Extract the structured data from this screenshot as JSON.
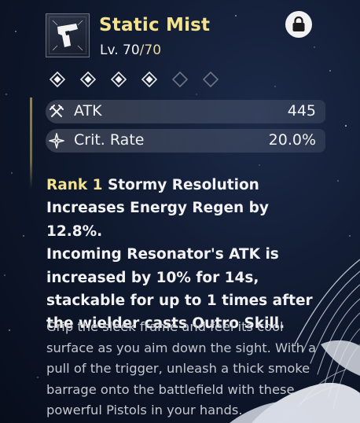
{
  "weapon": {
    "name": "Static Mist",
    "level_prefix": "Lv. ",
    "level_current": "70",
    "level_max": "/70",
    "icon": "pistol-icon",
    "locked": true
  },
  "rank_diamonds": [
    {
      "filled": true
    },
    {
      "filled": true
    },
    {
      "filled": true
    },
    {
      "filled": true
    },
    {
      "filled": false
    },
    {
      "filled": false
    }
  ],
  "stats": [
    {
      "icon": "atk-crossed-swords-icon",
      "label": "ATK",
      "value": "445"
    },
    {
      "icon": "crit-rate-sparkle-icon",
      "label": "Crit. Rate",
      "value": "20.0%"
    }
  ],
  "passive": {
    "rank": "Rank 1",
    "name": "Stormy Resolution",
    "line1": "Increases Energy Regen by 12.8%.",
    "line2": "Incoming Resonator's ATK is increased by 10% for 14s, stackable for up to 1 times after the wielder casts Outro Skill."
  },
  "lore": "Grip the sleek frame and feel its cool surface as you aim down the sight. With a pull of the trigger, unleash a thick smoke barrage onto the battlefield with these powerful Pistols in your hands.",
  "colors": {
    "title_gold": "#f4e28c",
    "text": "#f2f2f2",
    "lore_text": "#c4c7cd",
    "background": "#101a30"
  }
}
